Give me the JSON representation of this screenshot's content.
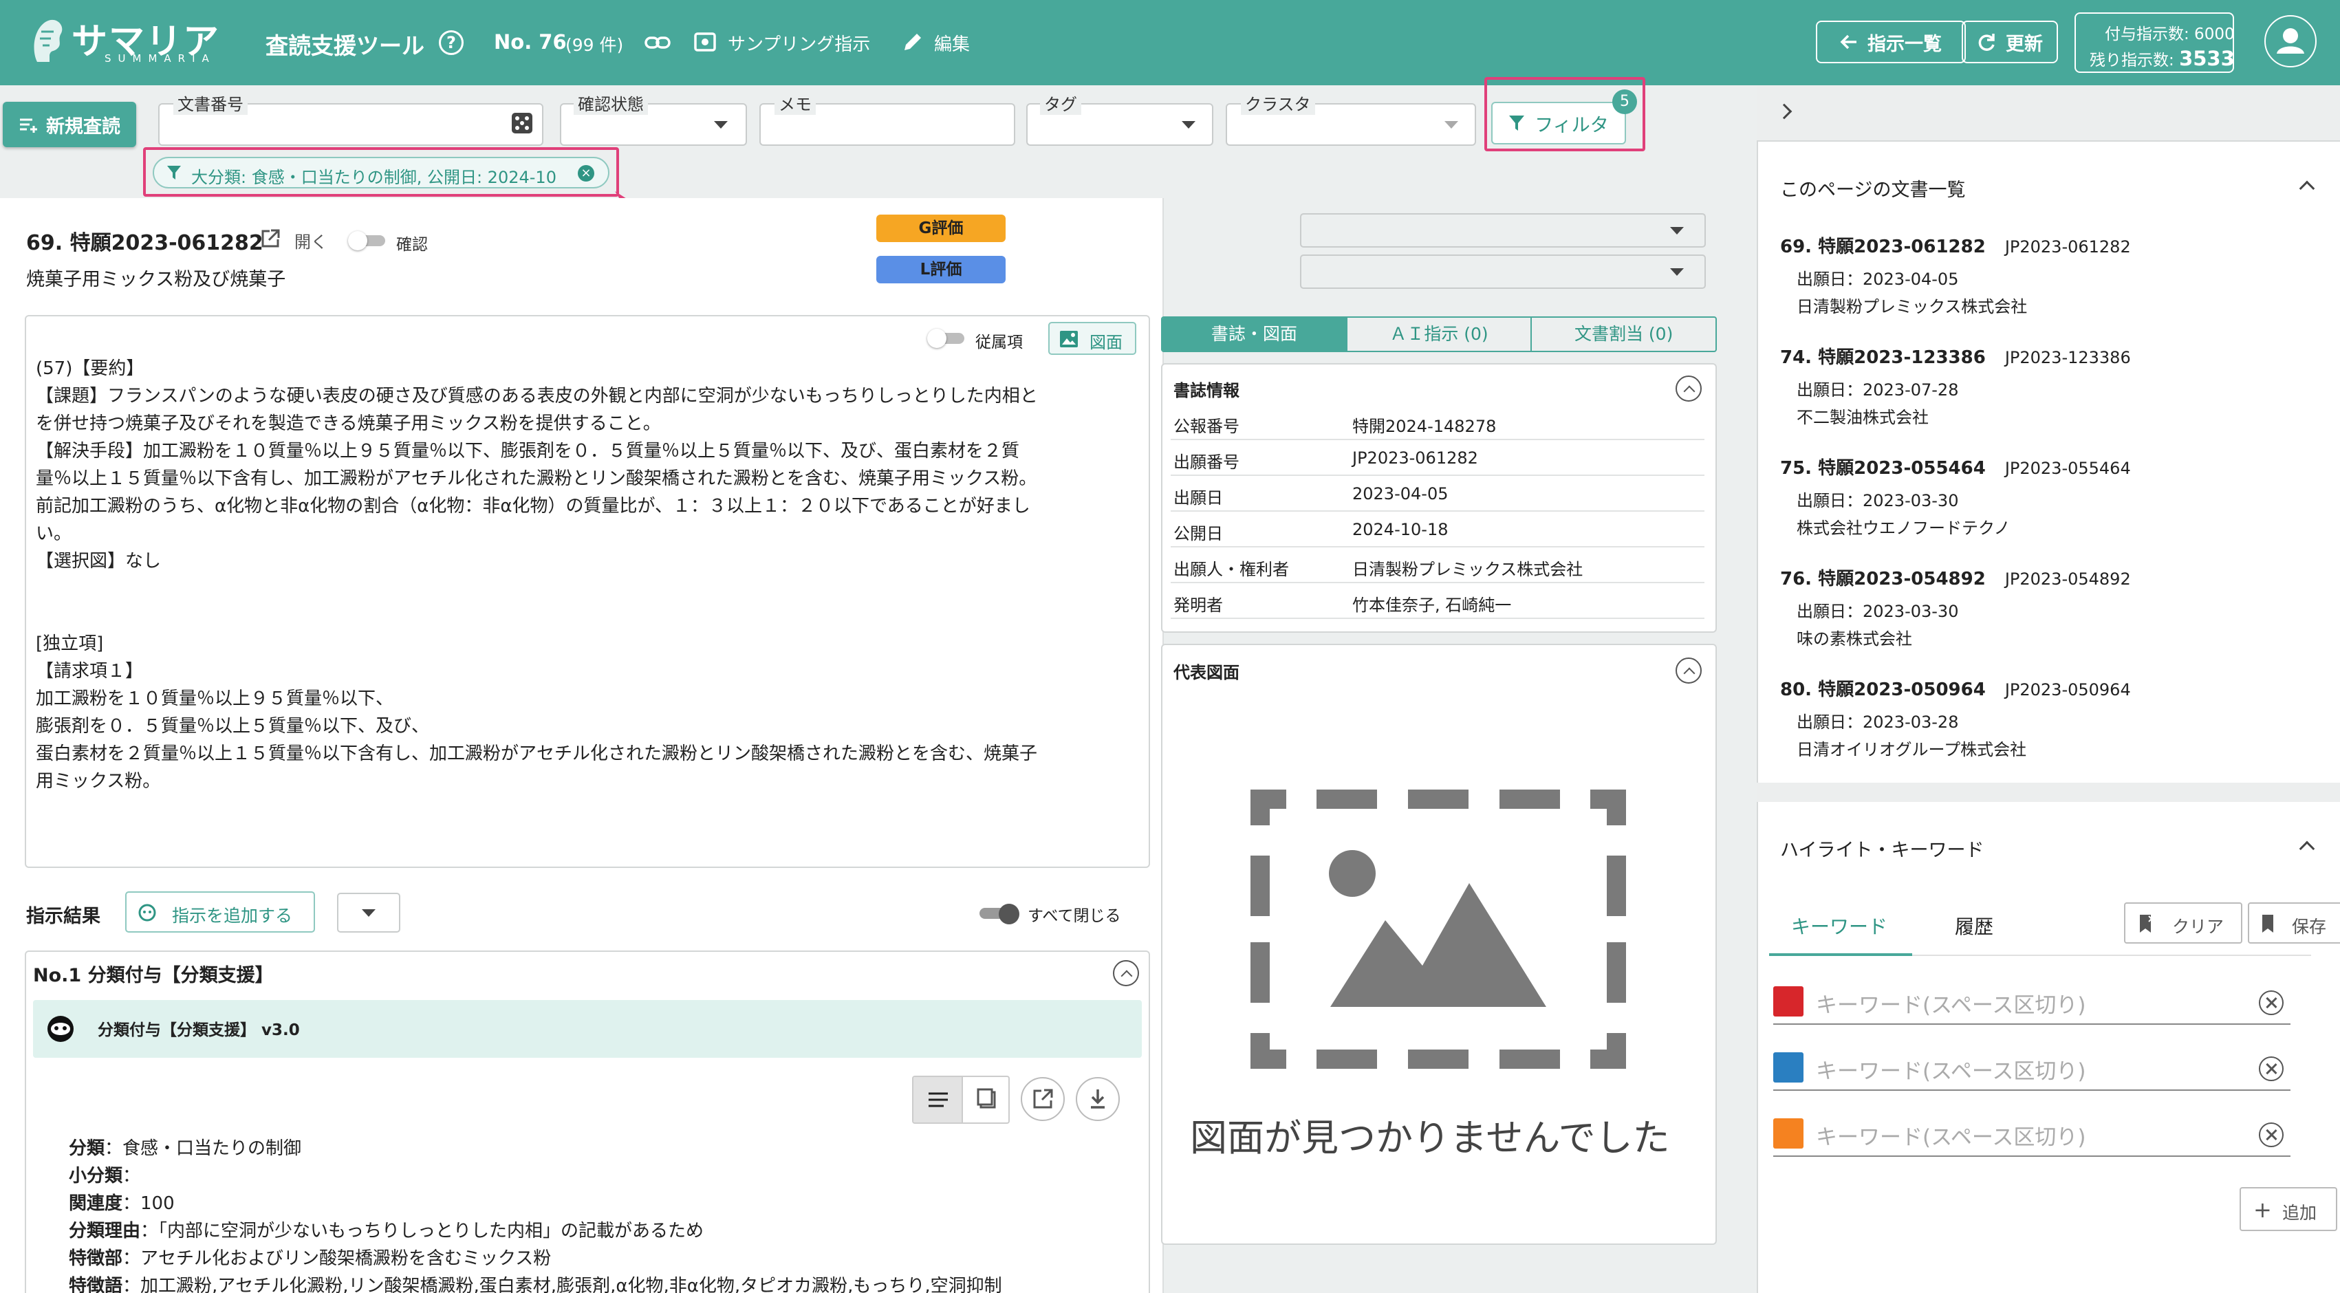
{
  "header": {
    "logo": "サマリア",
    "logo_sub": "SUMMARIA",
    "title": "査読支援ツール",
    "doc_no": "No. 76",
    "doc_count": "(99 件)",
    "sampling": "サンプリング指示",
    "edit": "編集",
    "back_btn": "指示一覧",
    "refresh_btn": "更新",
    "quota_line1": "付与指示数: 6000",
    "quota_line2_label": "残り指示数:",
    "quota_line2_value": "3533"
  },
  "toolbar": {
    "new_review": "新規査読",
    "doc_number_label": "文書番号",
    "status_label": "確認状態",
    "memo_label": "メモ",
    "tag_label": "タグ",
    "cluster_label": "クラスタ",
    "filter_btn": "フィルタ",
    "filter_count": "5",
    "filter_chip": "大分類: 食感・口当たりの制御, 公開日: 2024-10"
  },
  "doc": {
    "title": "69. 特願2023-061282",
    "open": "開く",
    "confirm": "確認",
    "subtitle": "焼菓子用ミックス粉及び焼菓子",
    "g_eval": "G評価",
    "l_eval": "L評価",
    "dependent_toggle": "従属項",
    "figure_btn": "図面"
  },
  "body_lines": [
    "(57)【要約】",
    "【課題】フランスパンのような硬い表皮の硬さ及び質感のある表皮の外観と内部に空洞が少ないもっちりしっとりした内相と",
    "を併せ持つ焼菓子及びそれを製造できる焼菓子用ミックス粉を提供すること。",
    "【解決手段】加工澱粉を１０質量％以上９５質量％以下、膨張剤を０．５質量％以上５質量％以下、及び、蛋白素材を２質",
    "量％以上１５質量％以下含有し、加工澱粉がアセチル化された澱粉とリン酸架橋された澱粉とを含む、焼菓子用ミックス粉。",
    "前記加工澱粉のうち、α化物と非α化物の割合（α化物：非α化物）の質量比が、１：３以上１：２０以下であることが好まし",
    "い。",
    "【選択図】なし",
    "",
    "",
    "[独立項]",
    "【請求項１】",
    "加工澱粉を１０質量％以上９５質量％以下、",
    "膨張剤を０．５質量％以上５質量％以下、及び、",
    "蛋白素材を２質量％以上１５質量％以下含有し、加工澱粉がアセチル化された澱粉とリン酸架橋された澱粉とを含む、焼菓子",
    "用ミックス粉。"
  ],
  "results": {
    "title": "指示結果",
    "add_btn": "指示を追加する",
    "close_all": "すべて閉じる",
    "item_title": "No.1 分類付与【分類支援】",
    "bot_title": "分類付与【分類支援】 v3.0",
    "lines": [
      {
        "k": "分類",
        "v": "：食感・口当たりの制御"
      },
      {
        "k": "小分類",
        "v": "："
      },
      {
        "k": "関連度",
        "v": "：100"
      },
      {
        "k": "分類理由",
        "v": "：「内部に空洞が少ないもっちりしっとりした内相」の記載があるため"
      },
      {
        "k": "特徴部",
        "v": "：アセチル化およびリン酸架橋澱粉を含むミックス粉"
      },
      {
        "k": "特徴語",
        "v": "：加工澱粉,アセチル化澱粉,リン酸架橋澱粉,蛋白素材,膨張剤,α化物,非α化物,タピオカ澱粉,もっちり,空洞抑制"
      }
    ]
  },
  "tabs": [
    "書誌・図面",
    "ＡＩ指示 (0)",
    "文書割当 (0)"
  ],
  "biblio": {
    "title": "書誌情報",
    "rows": [
      {
        "k": "公報番号",
        "v": "特開2024-148278"
      },
      {
        "k": "出願番号",
        "v": "JP2023-061282"
      },
      {
        "k": "出願日",
        "v": "2023-04-05"
      },
      {
        "k": "公開日",
        "v": "2024-10-18"
      },
      {
        "k": "出願人・権利者",
        "v": "日清製粉プレミックス株式会社"
      },
      {
        "k": "発明者",
        "v": "竹本佳奈子, 石崎純一"
      }
    ]
  },
  "figure": {
    "title": "代表図面",
    "missing": "図面が見つかりませんでした"
  },
  "sidebar": {
    "list_title": "このページの文書一覧",
    "docs": [
      {
        "t": "69. 特願2023-061282",
        "id": "JP2023-061282",
        "date": "出願日：2023-04-05",
        "co": "日清製粉プレミックス株式会社"
      },
      {
        "t": "74. 特願2023-123386",
        "id": "JP2023-123386",
        "date": "出願日：2023-07-28",
        "co": "不二製油株式会社"
      },
      {
        "t": "75. 特願2023-055464",
        "id": "JP2023-055464",
        "date": "出願日：2023-03-30",
        "co": "株式会社ウエノフードテクノ"
      },
      {
        "t": "76. 特願2023-054892",
        "id": "JP2023-054892",
        "date": "出願日：2023-03-30",
        "co": "味の素株式会社"
      },
      {
        "t": "80. 特願2023-050964",
        "id": "JP2023-050964",
        "date": "出願日：2023-03-28",
        "co": "日清オイリオグループ株式会社"
      }
    ],
    "hl_title": "ハイライト・キーワード",
    "tab_kw": "キーワード",
    "tab_hist": "履歴",
    "clear": "クリア",
    "save": "保存",
    "kw_placeholder": "キーワード(スペース区切り)",
    "kw_colors": [
      "#d7262b",
      "#2a7fc1",
      "#f58220"
    ],
    "add": "追加"
  }
}
